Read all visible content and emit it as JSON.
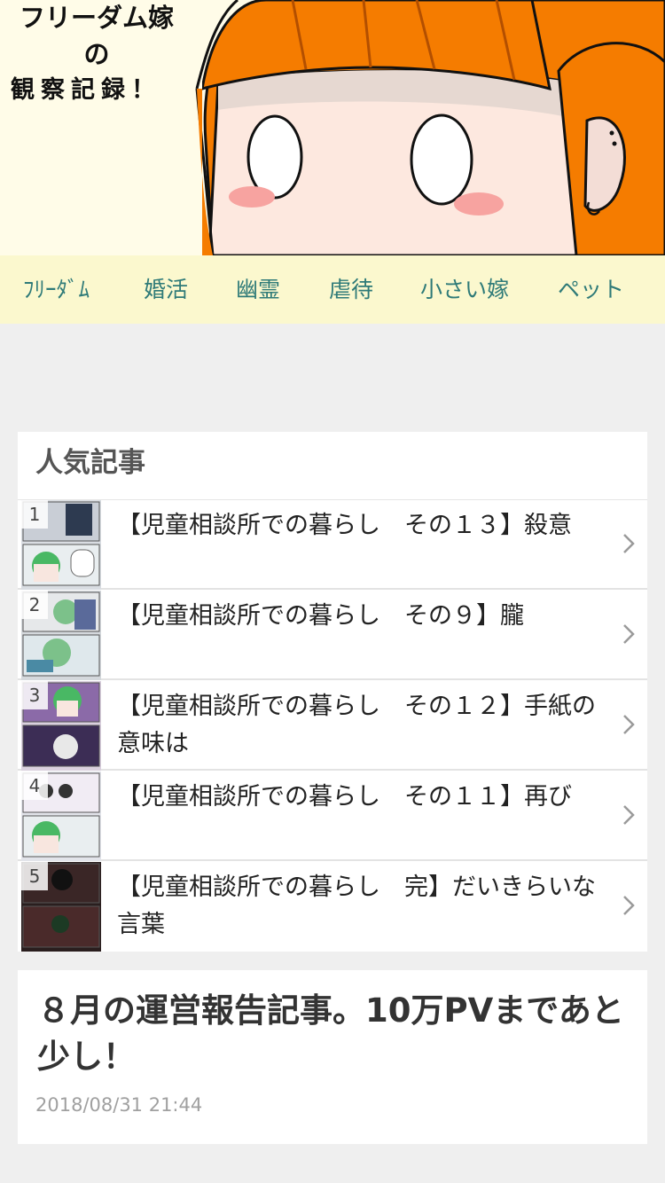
{
  "header": {
    "title_line1": "フリーダム嫁",
    "title_line2": "の",
    "title_line3": "観察記録！",
    "colors": {
      "hair": "#f57c00",
      "skin": "#fde8df",
      "cheek": "#f7a3a0",
      "background": "#fffce8"
    }
  },
  "nav": {
    "items": [
      {
        "label": "ﾌﾘｰﾀﾞﾑ"
      },
      {
        "label": "婚活"
      },
      {
        "label": "幽霊"
      },
      {
        "label": "虐待"
      },
      {
        "label": "小さい嫁"
      },
      {
        "label": "ペット"
      }
    ]
  },
  "popular": {
    "heading": "人気記事",
    "items": [
      {
        "rank": "1",
        "title": "【児童相談所での暮らし　その１３】殺意",
        "thumb_icon": "manga-thumbnail-icon"
      },
      {
        "rank": "2",
        "title": "【児童相談所での暮らし　その９】朧",
        "thumb_icon": "manga-thumbnail-icon"
      },
      {
        "rank": "3",
        "title": "【児童相談所での暮らし　その１２】手紙の意味は",
        "thumb_icon": "manga-thumbnail-icon"
      },
      {
        "rank": "4",
        "title": "【児童相談所での暮らし　その１１】再び",
        "thumb_icon": "manga-thumbnail-icon"
      },
      {
        "rank": "5",
        "title": "【児童相談所での暮らし　完】だいきらいな言葉",
        "thumb_icon": "manga-thumbnail-icon"
      }
    ]
  },
  "article": {
    "title": "８月の運営報告記事。10万PVまであと少し！",
    "date": "2018/08/31 21:44"
  }
}
